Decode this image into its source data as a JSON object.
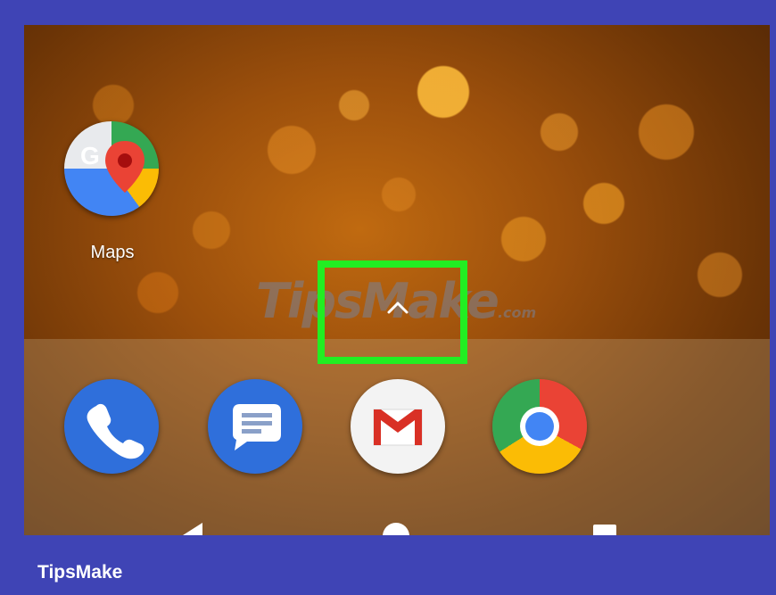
{
  "home_screen": {
    "apps": [
      {
        "label": "Maps",
        "icon": "google-maps-icon"
      }
    ],
    "dock": [
      {
        "icon": "phone-icon"
      },
      {
        "icon": "messages-icon"
      },
      {
        "icon": "gmail-icon"
      },
      {
        "icon": "chrome-icon"
      }
    ],
    "app_drawer_handle_icon": "chevron-up-icon",
    "navigation": [
      "back-icon",
      "home-icon",
      "recents-icon"
    ]
  },
  "watermark": {
    "text": "TipsMake",
    "suffix": ".com"
  },
  "footer": {
    "brand": "TipsMake"
  },
  "colors": {
    "frame": "#3f44b5",
    "highlight": "#22ee22",
    "wallpaper": "#9b4f0c"
  }
}
